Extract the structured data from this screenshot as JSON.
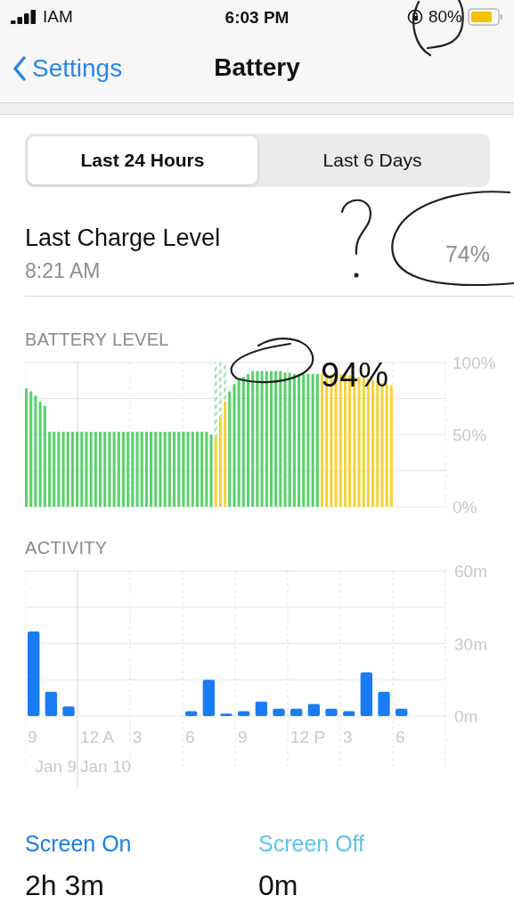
{
  "status_bar": {
    "carrier": "IAM",
    "time": "6:03 PM",
    "battery_percent": "80%"
  },
  "nav": {
    "back": "Settings",
    "title": "Battery"
  },
  "tabs": [
    {
      "label": "Last 24 Hours",
      "selected": true
    },
    {
      "label": "Last 6 Days",
      "selected": false
    }
  ],
  "last_charge": {
    "title": "Last Charge Level",
    "time": "8:21 AM",
    "level": "74%"
  },
  "battery_level": {
    "title": "BATTERY LEVEL",
    "overlay_note": "94%",
    "chart_data": {
      "type": "bar",
      "stacked": true,
      "ylim": [
        0,
        100
      ],
      "yticks": [
        {
          "value": 0,
          "label": "0%"
        },
        {
          "value": 50,
          "label": "50%"
        },
        {
          "value": 100,
          "label": "100%"
        }
      ],
      "categories": [
        null,
        null,
        null,
        null,
        null,
        null,
        null,
        null,
        null,
        null,
        null,
        null,
        null,
        null,
        null,
        null,
        null,
        null,
        null,
        null,
        null,
        null,
        null,
        null,
        null,
        null,
        null,
        null,
        null,
        null,
        null,
        null,
        null,
        null,
        null,
        null,
        null,
        null,
        null,
        null,
        null,
        null,
        null,
        null,
        null,
        null,
        null,
        null,
        null,
        null,
        null,
        null,
        null,
        null,
        null,
        null,
        null,
        null,
        null,
        null,
        null,
        null,
        null,
        null,
        null,
        null,
        null,
        null,
        null,
        null,
        null,
        null,
        null,
        null,
        null,
        null,
        null,
        null,
        null,
        null,
        null,
        null,
        null,
        null,
        null,
        null,
        null,
        null,
        null,
        null,
        null
      ],
      "series": [
        {
          "color": "#5bd16d",
          "values": [
            82,
            80,
            77,
            73,
            70,
            52,
            52,
            52,
            52,
            52,
            52,
            52,
            52,
            52,
            52,
            52,
            52,
            52,
            52,
            52,
            52,
            52,
            52,
            52,
            52,
            52,
            52,
            52,
            52,
            52,
            52,
            52,
            52,
            52,
            52,
            52,
            52,
            52,
            52,
            52,
            50,
            null,
            null,
            null,
            80,
            85,
            88,
            90,
            92,
            94,
            94,
            94,
            94,
            94,
            94,
            94,
            93,
            93,
            92,
            92,
            92,
            92,
            92,
            92,
            null,
            null,
            null,
            null,
            null,
            null,
            null,
            null,
            null,
            null,
            null,
            null,
            null,
            null,
            null,
            null,
            null,
            null,
            null,
            null,
            null,
            null,
            null,
            null,
            null,
            null,
            null
          ]
        },
        {
          "color": "#f5d33a",
          "values": [
            null,
            null,
            null,
            null,
            null,
            null,
            null,
            null,
            null,
            null,
            null,
            null,
            null,
            null,
            null,
            null,
            null,
            null,
            null,
            null,
            null,
            null,
            null,
            null,
            null,
            null,
            null,
            null,
            null,
            null,
            null,
            null,
            null,
            null,
            null,
            null,
            null,
            null,
            null,
            null,
            null,
            48,
            62,
            73,
            null,
            null,
            null,
            null,
            null,
            null,
            null,
            null,
            null,
            null,
            null,
            null,
            null,
            null,
            null,
            null,
            null,
            null,
            null,
            null,
            92,
            92,
            92,
            92,
            92,
            92,
            91,
            90,
            90,
            90,
            89,
            88,
            87,
            86,
            85,
            84,
            null,
            null,
            null,
            null,
            null,
            null,
            null,
            null,
            null,
            null,
            null
          ]
        },
        {
          "color": "#a8e6b4",
          "values": [
            null,
            null,
            null,
            null,
            null,
            null,
            null,
            null,
            null,
            null,
            null,
            null,
            null,
            null,
            null,
            null,
            null,
            null,
            null,
            null,
            null,
            null,
            null,
            null,
            null,
            null,
            null,
            null,
            null,
            null,
            null,
            null,
            null,
            null,
            null,
            null,
            null,
            null,
            null,
            null,
            null,
            52,
            38,
            27,
            null,
            null,
            null,
            null,
            null,
            null,
            null,
            null,
            null,
            null,
            null,
            null,
            null,
            null,
            null,
            null,
            null,
            null,
            null,
            null,
            null,
            null,
            null,
            null,
            null,
            null,
            null,
            null,
            null,
            null,
            null,
            null,
            null,
            null,
            null,
            null,
            null,
            null,
            null,
            null,
            null,
            null,
            null,
            null,
            null,
            null,
            null
          ]
        }
      ]
    }
  },
  "activity": {
    "title": "ACTIVITY",
    "dates": [
      "Jan 9",
      "Jan 10"
    ],
    "chart_data": {
      "type": "bar",
      "ylim": [
        0,
        60
      ],
      "yticks": [
        {
          "value": 0,
          "label": "0m"
        },
        {
          "value": 30,
          "label": "30m"
        },
        {
          "value": 60,
          "label": "60m"
        }
      ],
      "categories": [
        "9",
        null,
        null,
        "12 A",
        null,
        null,
        "3",
        null,
        null,
        "6",
        null,
        null,
        "9",
        null,
        null,
        "12 P",
        null,
        null,
        "3",
        null,
        null,
        "6",
        null,
        null
      ],
      "series": [
        {
          "color": "#1a7cf5",
          "values": [
            35,
            10,
            4,
            0,
            0,
            0,
            0,
            0,
            0,
            2,
            15,
            1,
            2,
            6,
            3,
            3,
            5,
            3,
            2,
            18,
            10,
            3,
            null,
            null
          ]
        }
      ]
    }
  },
  "totals": [
    {
      "label": "Screen On",
      "value": "2h 3m",
      "color": "#1a7fe0"
    },
    {
      "label": "Screen Off",
      "value": "0m",
      "color": "#5ec3ec"
    }
  ],
  "ink_marks": [
    {
      "kind": "loop"
    },
    {
      "kind": "question_mark"
    },
    {
      "kind": "loop"
    },
    {
      "kind": "loop"
    }
  ]
}
